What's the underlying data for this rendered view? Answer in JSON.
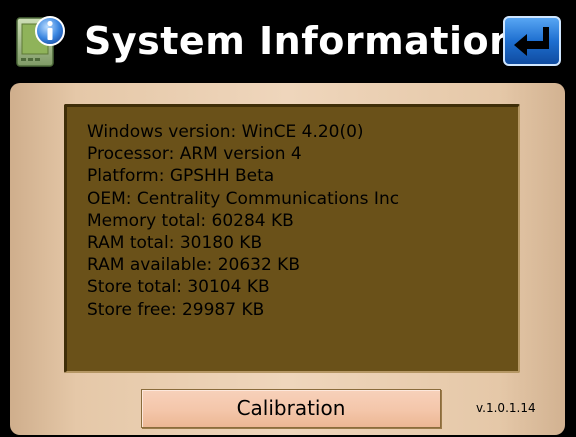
{
  "titlebar": {
    "title": "System Information",
    "app_icon": "info-device-icon",
    "back_icon": "return-arrow-icon"
  },
  "info": {
    "lines": [
      "Windows version: WinCE 4.20(0)",
      "Processor: ARM version 4",
      "Platform: GPSHH Beta",
      "OEM: Centrality Communications Inc",
      "Memory total: 60284 KB",
      "RAM total: 30180 KB",
      "RAM available: 20632 KB",
      "Store total: 30104 KB",
      "Store free: 29987 KB"
    ]
  },
  "footer": {
    "calibration_label": "Calibration",
    "version": "v.1.0.1.14"
  },
  "colors": {
    "background": "#000000",
    "title_text": "#ffffff",
    "panel": "#e5c8a8",
    "info_box": "#6a5119",
    "button": "#f4c6aa",
    "back_button": "#1e6fd0"
  }
}
